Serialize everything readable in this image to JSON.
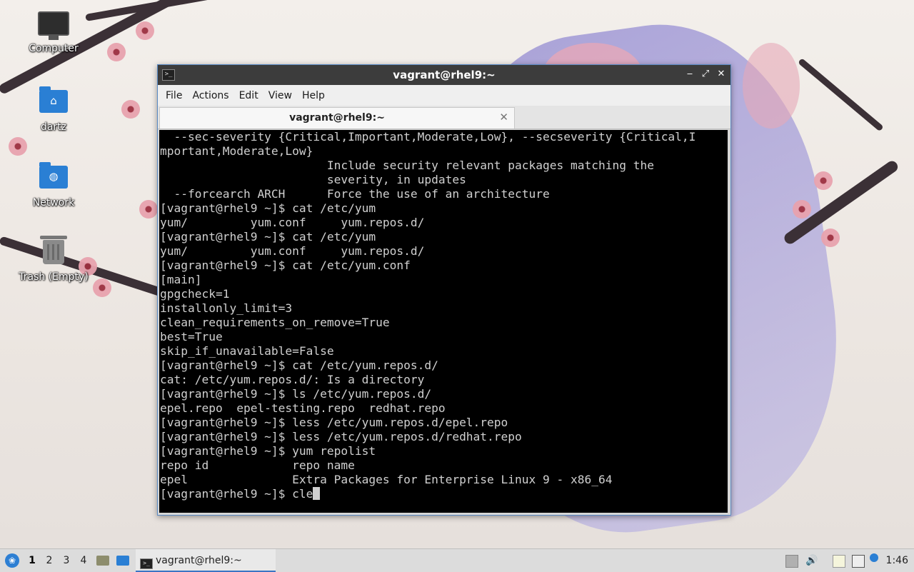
{
  "desktop": {
    "icons": [
      {
        "label": "Computer",
        "icon": "computer-icon"
      },
      {
        "label": "dartz",
        "icon": "home-folder-icon"
      },
      {
        "label": "Network",
        "icon": "network-folder-icon"
      },
      {
        "label": "Trash (Empty)",
        "icon": "trash-icon"
      }
    ]
  },
  "window": {
    "title": "vagrant@rhel9:~",
    "menu": [
      "File",
      "Actions",
      "Edit",
      "View",
      "Help"
    ],
    "tab_label": "vagrant@rhel9:~",
    "tab_close": "✕",
    "controls": {
      "minimize": "‒",
      "maximize": "⤢",
      "close": "✕"
    }
  },
  "terminal": {
    "lines": [
      "  --sec-severity {Critical,Important,Moderate,Low}, --secseverity {Critical,I",
      "mportant,Moderate,Low}",
      "                        Include security relevant packages matching the",
      "                        severity, in updates",
      "  --forcearch ARCH      Force the use of an architecture",
      "[vagrant@rhel9 ~]$ cat /etc/yum",
      "yum/         yum.conf     yum.repos.d/",
      "[vagrant@rhel9 ~]$ cat /etc/yum",
      "yum/         yum.conf     yum.repos.d/",
      "[vagrant@rhel9 ~]$ cat /etc/yum.conf",
      "[main]",
      "gpgcheck=1",
      "installonly_limit=3",
      "clean_requirements_on_remove=True",
      "best=True",
      "skip_if_unavailable=False",
      "[vagrant@rhel9 ~]$ cat /etc/yum.repos.d/",
      "cat: /etc/yum.repos.d/: Is a directory",
      "[vagrant@rhel9 ~]$ ls /etc/yum.repos.d/",
      "epel.repo  epel-testing.repo  redhat.repo",
      "[vagrant@rhel9 ~]$ less /etc/yum.repos.d/epel.repo",
      "[vagrant@rhel9 ~]$ less /etc/yum.repos.d/redhat.repo",
      "[vagrant@rhel9 ~]$ yum repolist",
      "repo id            repo name",
      "epel               Extra Packages for Enterprise Linux 9 - x86_64"
    ],
    "current_input": "[vagrant@rhel9 ~]$ cle"
  },
  "taskbar": {
    "workspaces": [
      "1",
      "2",
      "3",
      "4"
    ],
    "active_workspace": "1",
    "task_label": "vagrant@rhel9:~",
    "clock": "1:46",
    "colors": {
      "accent": "#3a74c4",
      "folder": "#2a7fd4"
    }
  }
}
